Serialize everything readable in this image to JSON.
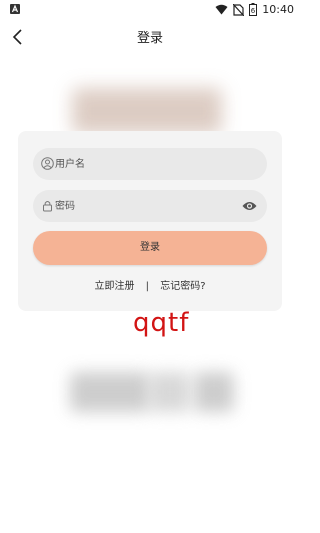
{
  "status_bar": {
    "time": "10:40",
    "battery_level": "6",
    "icons": [
      "app-notification-icon",
      "wifi-icon",
      "no-sim-icon",
      "battery-icon"
    ]
  },
  "header": {
    "title": "登录",
    "back_icon": "back-arrow-icon"
  },
  "form": {
    "username_placeholder": "用户名",
    "password_placeholder": "密码",
    "username_icon": "user-icon",
    "password_icon": "lock-icon",
    "visibility_icon": "eye-icon",
    "login_label": "登录"
  },
  "links": {
    "register": "立即注册",
    "separator": "|",
    "forgot_password": "忘记密码?"
  },
  "overlay_text": "qqtf",
  "colors": {
    "card_bg": "#f4f4f4",
    "field_bg": "#e9e9e9",
    "login_button": "#f5b395",
    "overlay_text": "#d21414"
  }
}
